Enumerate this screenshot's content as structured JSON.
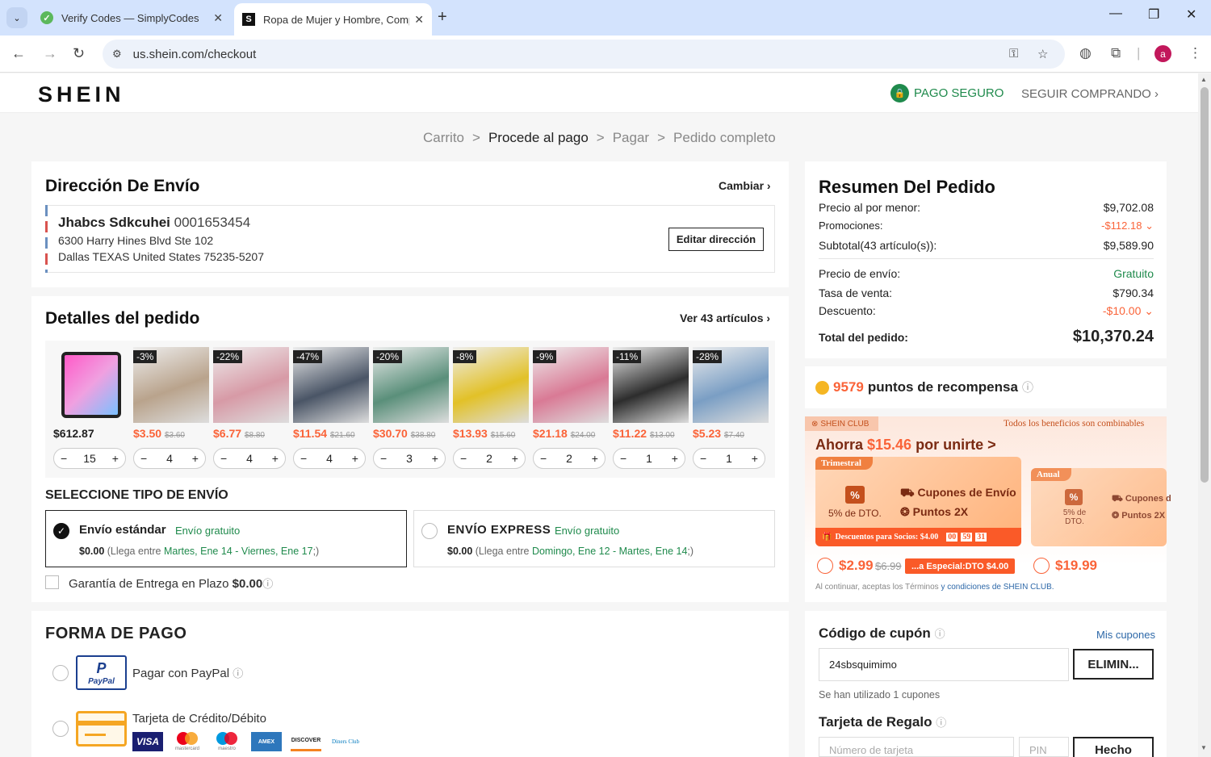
{
  "browser": {
    "tabs": [
      {
        "title": "Verify Codes — SimplyCodes"
      },
      {
        "title": "Ropa de Mujer y Hombre, Compra"
      }
    ],
    "url": "us.shein.com/checkout",
    "avatar": "a"
  },
  "header": {
    "logo": "SHEIN",
    "secure": "PAGO SEGURO",
    "continue": "SEGUIR COMPRANDO"
  },
  "breadcrumb": [
    "Carrito",
    ">",
    "Procede al pago",
    ">",
    "Pagar",
    ">",
    "Pedido completo"
  ],
  "shipping_address": {
    "title": "Dirección De Envío",
    "change": "Cambiar",
    "name": "Jhabcs Sdkcuhei",
    "phone": "0001653454",
    "line1": "6300 Harry Hines Blvd Ste 102",
    "line2": "Dallas TEXAS United States 75235-5207",
    "edit": "Editar dirección"
  },
  "order": {
    "title": "Detalles del pedido",
    "view_all": "Ver 43 artículos",
    "items": [
      {
        "discount": "",
        "price": "$612.87",
        "orig": "",
        "qty": "15",
        "color": "#e84f9a"
      },
      {
        "discount": "-3%",
        "price": "$3.50",
        "orig": "$3.60",
        "qty": "4",
        "color": "#b9a38c"
      },
      {
        "discount": "-22%",
        "price": "$6.77",
        "orig": "$8.80",
        "qty": "4",
        "color": "#d79aa6"
      },
      {
        "discount": "-47%",
        "price": "$11.54",
        "orig": "$21.60",
        "qty": "4",
        "color": "#4a5566"
      },
      {
        "discount": "-20%",
        "price": "$30.70",
        "orig": "$38.80",
        "qty": "3",
        "color": "#5a8f7a"
      },
      {
        "discount": "-8%",
        "price": "$13.93",
        "orig": "$15.60",
        "qty": "2",
        "color": "#e2c128"
      },
      {
        "discount": "-9%",
        "price": "$21.18",
        "orig": "$24.00",
        "qty": "2",
        "color": "#d97a95"
      },
      {
        "discount": "-11%",
        "price": "$11.22",
        "orig": "$13.00",
        "qty": "1",
        "color": "#2d2d2d"
      },
      {
        "discount": "-28%",
        "price": "$5.23",
        "orig": "$7.40",
        "qty": "1",
        "color": "#7a9ec4"
      }
    ]
  },
  "shipping": {
    "title": "SELECCIONE TIPO DE ENVÍO",
    "standard": {
      "name": "Envío estándar",
      "free": "Envío gratuito",
      "price": "$0.00",
      "pre": "(Llega entre ",
      "dates": "Martes, Ene 14 - Viernes, Ene 17",
      "post": ";)"
    },
    "express": {
      "name": "ENVÍO EXPRESS",
      "free": "Envío gratuito",
      "price": "$0.00",
      "pre": "(Llega entre ",
      "dates": "Domingo, Ene 12 - Martes, Ene 14",
      "post": ";)"
    },
    "guarantee": "Garantía de Entrega en Plazo",
    "guarantee_price": "$0.00"
  },
  "payment": {
    "title": "FORMA DE PAGO",
    "paypal": "Pagar con PayPal",
    "card": "Tarjeta de Crédito/Débito",
    "brands": [
      "VISA",
      "mastercard",
      "maestro",
      "AMEX",
      "DISCOVER",
      "Diners Club"
    ],
    "paypal_logo": "PayPal"
  },
  "summary": {
    "title": "Resumen Del Pedido",
    "retail_label": "Precio al por menor:",
    "retail": "$9,702.08",
    "promo_label": "Promociones:",
    "promo": "-$112.18",
    "subtotal_label": "Subtotal(43 artículo(s)):",
    "subtotal": "$9,589.90",
    "ship_label": "Precio de envío:",
    "ship": "Gratuito",
    "tax_label": "Tasa de venta:",
    "tax": "$790.34",
    "disc_label": "Descuento:",
    "disc": "-$10.00",
    "total_label": "Total del pedido:",
    "total": "$10,370.24"
  },
  "points": {
    "value": "9579",
    "label": "puntos de recompensa"
  },
  "club": {
    "badge": "SHEIN CLUB",
    "combinable": "Todos los beneficios son combinables",
    "save_pre": "Ahorra ",
    "save_amt": "$15.46",
    "save_post": " por unirte >",
    "plan1": {
      "tag": "Trimestral",
      "off": "5% de DTO.",
      "coupons": "Cupones de Envío",
      "points": "Puntos 2X",
      "bar": "Descuentos para Socios: $4.00",
      "timer": [
        "00",
        "59",
        "31"
      ],
      "price": "$2.99",
      "orig": "$6.99",
      "special": "...a Especial:DTO $4.00"
    },
    "plan2": {
      "tag": "Anual",
      "off": "5% de DTO.",
      "coupons": "Cupones d",
      "points": "Puntos 2X",
      "price": "$19.99"
    },
    "terms_pre": "Al continuar, aceptas los Términos ",
    "terms_link": "y condiciones de SHEIN CLUB."
  },
  "coupon": {
    "title": "Código de cupón",
    "mine": "Mis cupones",
    "value": "24sbsquimimo",
    "remove": "ELIMIN...",
    "used": "Se han utilizado 1 cupones"
  },
  "gift": {
    "title": "Tarjeta de Regalo",
    "card_ph": "Número de tarjeta",
    "pin_ph": "PIN",
    "done": "Hecho"
  }
}
